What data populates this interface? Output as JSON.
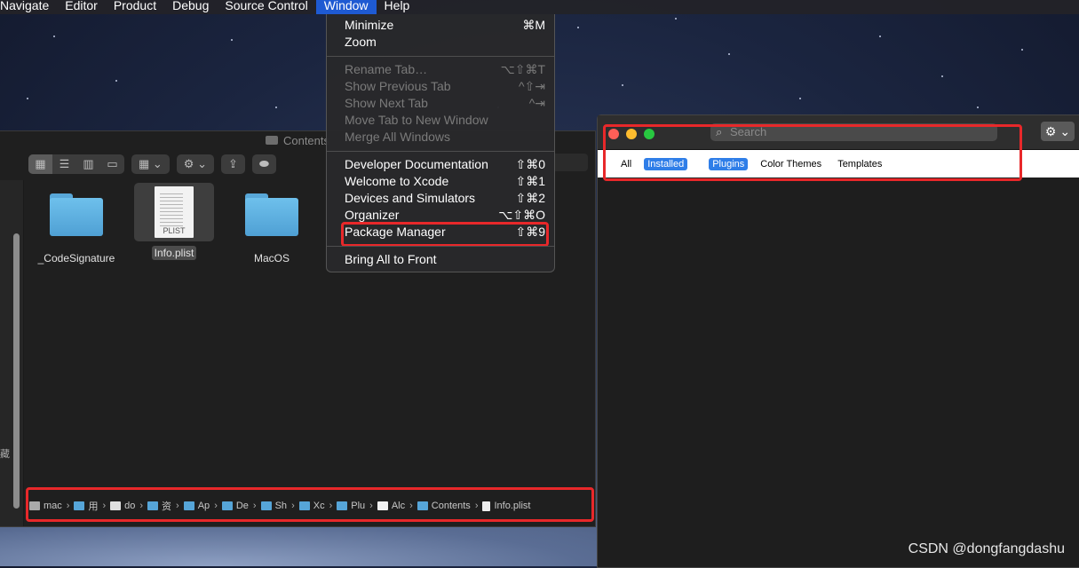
{
  "menubar": {
    "items": [
      "Navigate",
      "Editor",
      "Product",
      "Debug",
      "Source Control",
      "Window",
      "Help"
    ],
    "active": "Window"
  },
  "window_menu": {
    "groups": [
      [
        {
          "label": "Minimize",
          "shortcut": "⌘M",
          "enabled": true
        },
        {
          "label": "Zoom",
          "shortcut": "",
          "enabled": true
        }
      ],
      [
        {
          "label": "Rename Tab…",
          "shortcut": "⌥⇧⌘T",
          "enabled": false
        },
        {
          "label": "Show Previous Tab",
          "shortcut": "^⇧⇥",
          "enabled": false
        },
        {
          "label": "Show Next Tab",
          "shortcut": "^⇥",
          "enabled": false
        },
        {
          "label": "Move Tab to New Window",
          "shortcut": "",
          "enabled": false
        },
        {
          "label": "Merge All Windows",
          "shortcut": "",
          "enabled": false
        }
      ],
      [
        {
          "label": "Developer Documentation",
          "shortcut": "⇧⌘0",
          "enabled": true
        },
        {
          "label": "Welcome to Xcode",
          "shortcut": "⇧⌘1",
          "enabled": true
        },
        {
          "label": "Devices and Simulators",
          "shortcut": "⇧⌘2",
          "enabled": true
        },
        {
          "label": "Organizer",
          "shortcut": "⌥⇧⌘O",
          "enabled": true
        },
        {
          "label": "Package Manager",
          "shortcut": "⇧⌘9",
          "enabled": true,
          "highlighted_box": true
        }
      ],
      [
        {
          "label": "Bring All to Front",
          "shortcut": "",
          "enabled": true
        }
      ]
    ]
  },
  "finder": {
    "title": "Contents",
    "toolbar": {
      "view_modes": [
        "icon-view-icon",
        "list-view-icon",
        "column-view-icon",
        "gallery-view-icon"
      ],
      "selected_view": "icon-view-icon"
    },
    "side_char": "藏",
    "files": [
      {
        "name": "_CodeSignature",
        "kind": "folder",
        "selected": false
      },
      {
        "name": "Info.plist",
        "kind": "plist",
        "selected": true,
        "badge": "PLIST"
      },
      {
        "name": "MacOS",
        "kind": "folder",
        "selected": false
      }
    ],
    "path": [
      {
        "label": "mac",
        "icon": "hd-icon"
      },
      {
        "label": "用",
        "icon": "folder-icon"
      },
      {
        "label": "do",
        "icon": "home-icon"
      },
      {
        "label": "资",
        "icon": "folder-icon"
      },
      {
        "label": "Ap",
        "icon": "folder-icon"
      },
      {
        "label": "De",
        "icon": "folder-icon"
      },
      {
        "label": "Sh",
        "icon": "folder-icon"
      },
      {
        "label": "Xc",
        "icon": "folder-icon"
      },
      {
        "label": "Plu",
        "icon": "folder-icon"
      },
      {
        "label": "Alc",
        "icon": "app-icon"
      },
      {
        "label": "Contents",
        "icon": "folder-icon"
      },
      {
        "label": "Info.plist",
        "icon": "doc-icon"
      }
    ]
  },
  "package_manager": {
    "search_placeholder": "Search",
    "gear_label": "⚙︎ ⌄",
    "filters_group1": [
      {
        "label": "All",
        "on": false
      },
      {
        "label": "Installed",
        "on": true
      }
    ],
    "filters_group2": [
      {
        "label": "Plugins",
        "on": true
      },
      {
        "label": "Color Themes",
        "on": false
      },
      {
        "label": "Templates",
        "on": false
      }
    ],
    "traffic_lights": {
      "close": "#ff5f57",
      "minimize": "#febc2e",
      "zoom": "#28c840"
    }
  },
  "watermark": "CSDN @dongfangdashu",
  "colors": {
    "highlight_red": "#e8282a",
    "menu_active": "#1e5ad2",
    "filter_blue": "#2f7ee8"
  }
}
